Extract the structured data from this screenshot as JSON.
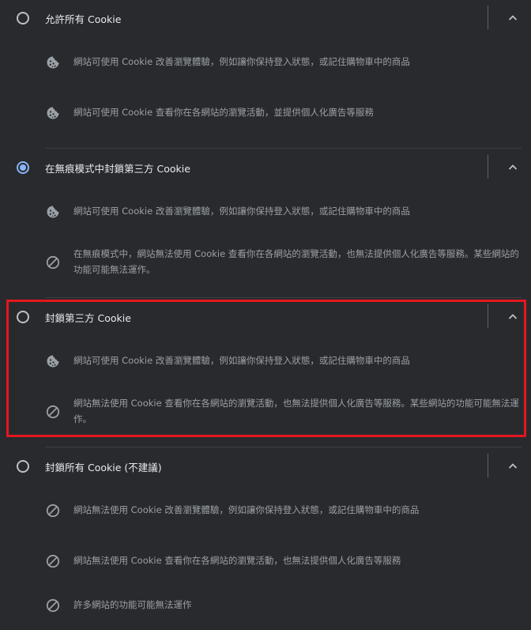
{
  "options": [
    {
      "title": "允許所有 Cookie",
      "selected": false,
      "rows": [
        {
          "icon": "cookie-icon",
          "text": "網站可使用 Cookie 改善瀏覽體驗，例如讓你保持登入狀態，或記住購物車中的商品"
        },
        {
          "icon": "cookie-icon",
          "text": "網站可使用 Cookie 查看你在各網站的瀏覽活動，並提供個人化廣告等服務"
        }
      ]
    },
    {
      "title": "在無痕模式中封鎖第三方 Cookie",
      "selected": true,
      "rows": [
        {
          "icon": "cookie-icon",
          "text": "網站可使用 Cookie 改善瀏覽體驗，例如讓你保持登入狀態，或記住購物車中的商品"
        },
        {
          "icon": "block-icon",
          "text": "在無痕模式中，網站無法使用 Cookie 查看你在各網站的瀏覽活動，也無法提供個人化廣告等服務。某些網站的功能可能無法運作。"
        }
      ]
    },
    {
      "title": "封鎖第三方 Cookie",
      "selected": false,
      "rows": [
        {
          "icon": "cookie-icon",
          "text": "網站可使用 Cookie 改善瀏覽體驗，例如讓你保持登入狀態，或記住購物車中的商品"
        },
        {
          "icon": "block-icon",
          "text": "網站無法使用 Cookie 查看你在各網站的瀏覽活動，也無法提供個人化廣告等服務。某些網站的功能可能無法運作。"
        }
      ]
    },
    {
      "title": "封鎖所有 Cookie (不建議)",
      "selected": false,
      "rows": [
        {
          "icon": "block-icon",
          "text": "網站無法使用 Cookie 改善瀏覽體驗，例如讓你保持登入狀態，或記住購物車中的商品"
        },
        {
          "icon": "block-icon",
          "text": "網站無法使用 Cookie 查看你在各網站的瀏覽活動，也無法提供個人化廣告等服務"
        },
        {
          "icon": "block-icon",
          "text": "許多網站的功能可能無法運作"
        }
      ]
    }
  ],
  "colors": {
    "background": "#292a2d",
    "title_text": "#e8eaed",
    "row_text": "#9aa0a6",
    "icon": "#9aa0a6",
    "radio_selected": "#8ab4f8",
    "highlight_border": "#e5161f"
  }
}
